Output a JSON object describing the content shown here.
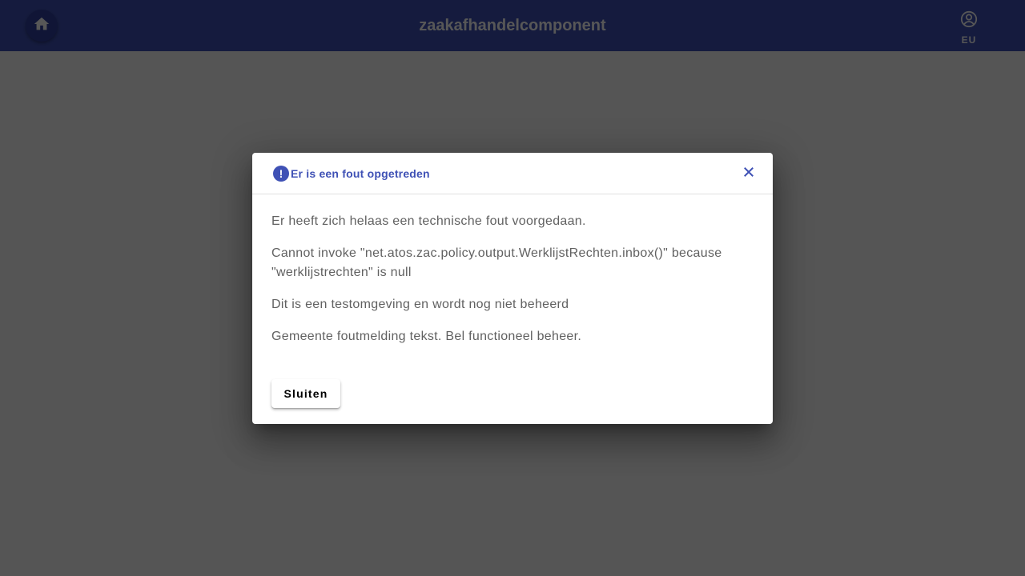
{
  "toolbar": {
    "title": "zaakafhandelcomponent",
    "home_icon": "home-icon",
    "user_icon": "account-circle-icon",
    "user_initials": "EU"
  },
  "dialog": {
    "icon": "error-icon",
    "icon_glyph": "!",
    "title": "Er is een fout opgetreden",
    "close_icon": "close-icon",
    "messages": [
      "Er heeft zich helaas een technische fout voorgedaan.",
      "Cannot invoke \"net.atos.zac.policy.output.WerklijstRechten.inbox()\" because \"werklijstrechten\" is null",
      "Dit is een testomgeving en wordt nog niet beheerd",
      "Gemeente foutmelding tekst. Bel functioneel beheer."
    ],
    "close_button_label": "Sluiten"
  },
  "colors": {
    "primary": "#3f51b5",
    "primary_dark": "#303f9f",
    "text_secondary": "#616161"
  }
}
